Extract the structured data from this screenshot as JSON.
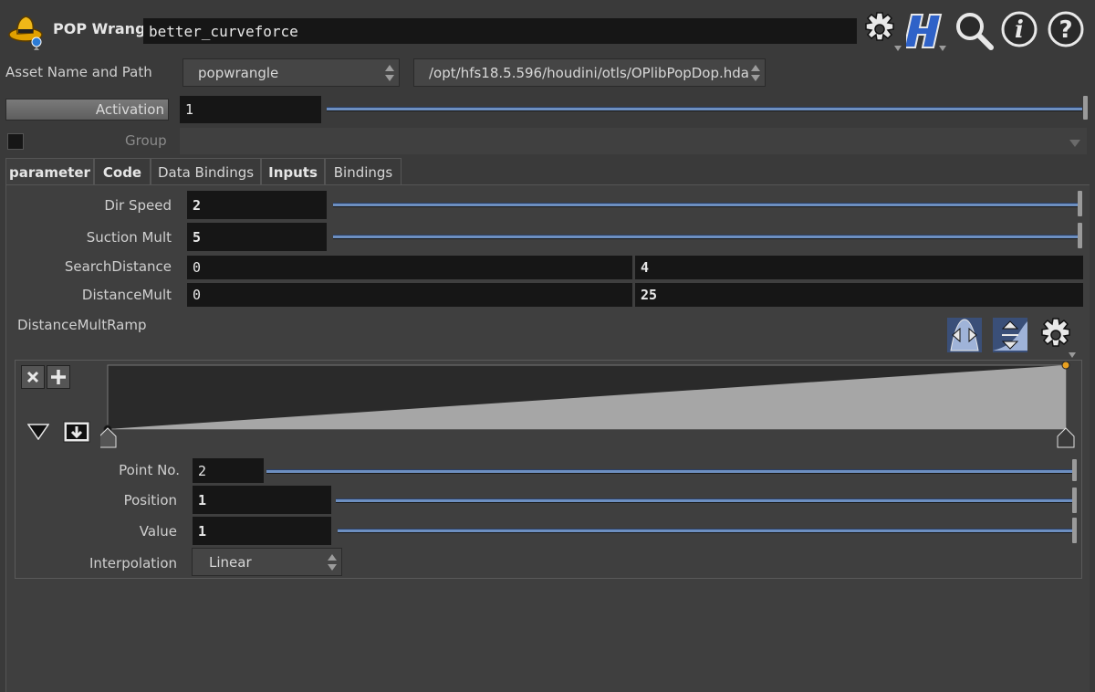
{
  "header": {
    "node_type": "POP Wrangle",
    "node_name": "better_curveforce",
    "icons": [
      "pop-wrangle-icon",
      "gear-icon",
      "houdini-help-icon",
      "search-icon",
      "info-icon",
      "help-icon"
    ]
  },
  "asset": {
    "label": "Asset Name and Path",
    "name": "popwrangle",
    "path": "/opt/hfs18.5.596/houdini/otls/OPlibPopDop.hda"
  },
  "activation": {
    "label": "Activation",
    "value": "1"
  },
  "group": {
    "label": "Group",
    "value": ""
  },
  "tabs": [
    "parameter",
    "Code",
    "Data Bindings",
    "Inputs",
    "Bindings"
  ],
  "params": {
    "dir_speed": {
      "label": "Dir Speed",
      "value": "2"
    },
    "suction_mult": {
      "label": "Suction Mult",
      "value": "5"
    },
    "search_distance": {
      "label": "SearchDistance",
      "min": "0",
      "max": "4"
    },
    "distance_mult": {
      "label": "DistanceMult",
      "min": "0",
      "max": "25"
    }
  },
  "ramp": {
    "label": "DistanceMultRamp",
    "point_no": {
      "label": "Point No.",
      "value": "2"
    },
    "position": {
      "label": "Position",
      "value": "1"
    },
    "value": {
      "label": "Value",
      "value": "1"
    },
    "interpolation": {
      "label": "Interpolation",
      "value": "Linear"
    },
    "points": [
      {
        "position": 0,
        "value": 0
      },
      {
        "position": 1,
        "value": 1
      }
    ]
  },
  "colors": {
    "background": "#3a3a3a",
    "field": "#161616",
    "slider": "#6d8fc0",
    "ramp_fill": "#a6a6a6",
    "selected_point": "#e8a020"
  }
}
